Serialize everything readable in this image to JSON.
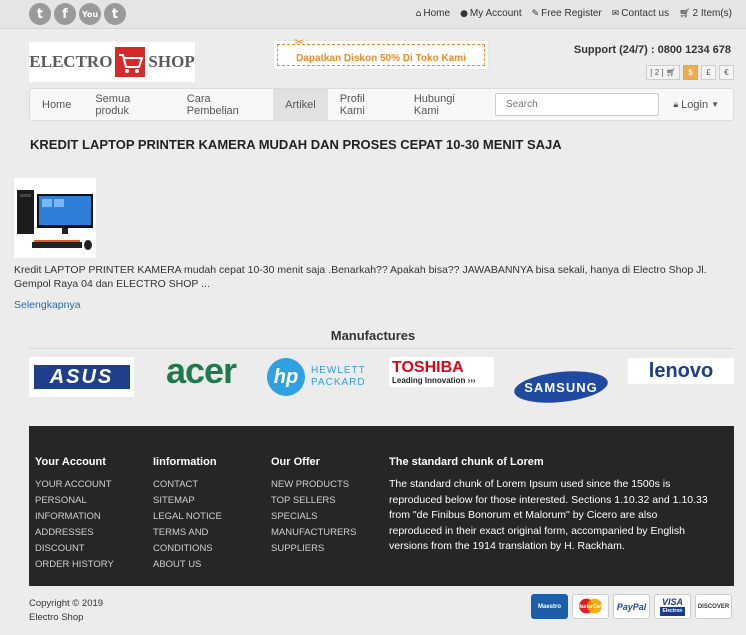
{
  "social": [
    "twitter-icon",
    "facebook-icon",
    "youtube-icon",
    "tumblr-icon"
  ],
  "social_glyphs": {
    "twitter": "t",
    "facebook": "f",
    "youtube": "You",
    "tumblr": "t"
  },
  "toplinks": {
    "home": "Home",
    "my_account": "My Account",
    "free_register": "Free Register",
    "contact": "Contact us",
    "cart": "2 Item(s)"
  },
  "logo": {
    "left": "ELECTRO",
    "right": "SHOP"
  },
  "promo": "Dapatkan Diskon 50% Di Toko Kami",
  "support": "Support (24/7) : 0800 1234 678",
  "currency": {
    "cart_count": "[ 2 ]",
    "options": [
      "$",
      "£",
      "€"
    ],
    "active": "$"
  },
  "nav": {
    "items": [
      "Home",
      "Semua produk",
      "Cara Pembelian",
      "Artikel",
      "Profil Kami",
      "Hubungi Kami"
    ],
    "active": "Artikel",
    "search_placeholder": "Search",
    "login": "Login"
  },
  "article": {
    "title": "KREDIT LAPTOP PRINTER KAMERA MUDAH DAN PROSES CEPAT 10-30 MENIT SAJA",
    "excerpt": "Kredit LAPTOP PRINTER KAMERA mudah cepat 10-30 menit saja .Benarkah?? Apakah bisa?? JAWABANNYA bisa sekali, hanya di Electro Shop Jl. Gempol Raya 04 dan ELECTRO SHOP ...",
    "more": "Selengkapnya"
  },
  "manufacturers": {
    "title": "Manufactures",
    "brands": {
      "asus": "ASUS",
      "acer": "acer",
      "hp_mark": "hp",
      "hp_line1": "HEWLETT",
      "hp_line2": "PACKARD",
      "toshiba": "TOSHIBA",
      "toshiba_tag": "Leading Innovation",
      "samsung": "SAMSUNG",
      "lenovo": "lenovo"
    }
  },
  "footer": {
    "account": {
      "title": "Your Account",
      "links": [
        "Your Account",
        "Personal",
        "Information",
        "Addresses",
        "Discount",
        "Order History"
      ]
    },
    "information": {
      "title": "Iinformation",
      "links": [
        "Contact",
        "Sitemap",
        "Legal Notice",
        "Terms and",
        "Conditions",
        "About Us"
      ]
    },
    "offer": {
      "title": "Our Offer",
      "links": [
        "New Products",
        "Top Sellers",
        "Specials",
        "Manufacturers",
        "Suppliers"
      ]
    },
    "lorem": {
      "title": "The standard chunk of Lorem",
      "text": "The standard chunk of Lorem Ipsum used since the 1500s is reproduced below for those interested. Sections 1.10.32 and 1.10.33 from \"de Finibus Bonorum et Malorum\" by Cicero are also reproduced in their exact original form, accompanied by English versions from the 1914 translation by H. Rackham."
    }
  },
  "copyright": {
    "line1": "Copyright © 2019",
    "line2": "Electro Shop"
  },
  "payments": {
    "maestro": "Maestro",
    "mastercard": "MasterCard",
    "paypal": "PayPal",
    "visa": "VISA",
    "visa_sub": "Electron",
    "discover": "DISCOVER"
  },
  "colors": {
    "accent": "#f08a2a",
    "link": "#2a6aad",
    "footer_bg": "#262626",
    "currency_active": "#f0ad4e"
  }
}
